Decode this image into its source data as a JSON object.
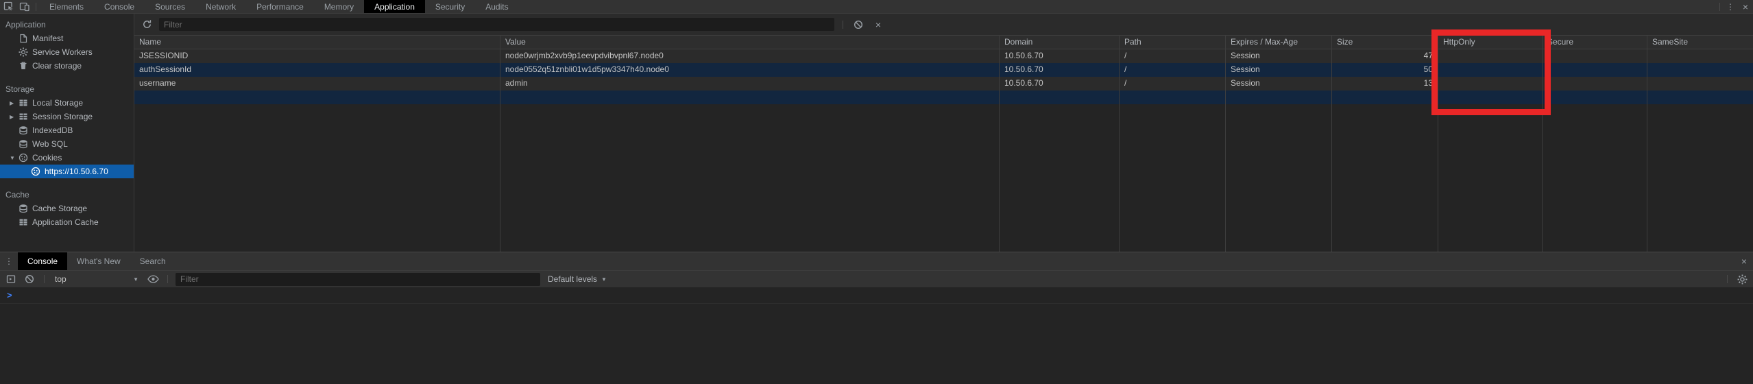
{
  "topbar": {
    "tabs": [
      {
        "label": "Elements",
        "active": false
      },
      {
        "label": "Console",
        "active": false
      },
      {
        "label": "Sources",
        "active": false
      },
      {
        "label": "Network",
        "active": false
      },
      {
        "label": "Performance",
        "active": false
      },
      {
        "label": "Memory",
        "active": false
      },
      {
        "label": "Application",
        "active": true
      },
      {
        "label": "Security",
        "active": false
      },
      {
        "label": "Audits",
        "active": false
      }
    ]
  },
  "icons": {
    "more_options": "⋮",
    "close": "×",
    "caret_down": "▼",
    "disclosure_collapsed": "▶",
    "disclosure_expanded": "▼"
  },
  "sidebar": {
    "sections": [
      {
        "title": "Application",
        "items": [
          {
            "label": "Manifest",
            "icon": "file-icon"
          },
          {
            "label": "Service Workers",
            "icon": "gear-icon"
          },
          {
            "label": "Clear storage",
            "icon": "trash-icon"
          }
        ]
      },
      {
        "title": "Storage",
        "items": [
          {
            "label": "Local Storage",
            "icon": "table-icon",
            "disclosure": "collapsed"
          },
          {
            "label": "Session Storage",
            "icon": "table-icon",
            "disclosure": "collapsed"
          },
          {
            "label": "IndexedDB",
            "icon": "database-icon"
          },
          {
            "label": "Web SQL",
            "icon": "database-icon"
          },
          {
            "label": "Cookies",
            "icon": "cookie-icon",
            "disclosure": "expanded"
          },
          {
            "label": "https://10.50.6.70",
            "icon": "cookie-icon",
            "selected": true
          }
        ]
      },
      {
        "title": "Cache",
        "items": [
          {
            "label": "Cache Storage",
            "icon": "database-icon"
          },
          {
            "label": "Application Cache",
            "icon": "table-icon"
          }
        ]
      }
    ]
  },
  "cookies": {
    "filter_placeholder": "Filter",
    "columns": [
      "Name",
      "Value",
      "Domain",
      "Path",
      "Expires / Max-Age",
      "Size",
      "HttpOnly",
      "Secure",
      "SameSite"
    ],
    "rows": [
      {
        "name": "JSESSIONID",
        "value": "node0wrjmb2xvb9p1eevpdvibvpnl67.node0",
        "domain": "10.50.6.70",
        "path": "/",
        "expires": "Session",
        "size": "47",
        "httponly": "",
        "secure": "",
        "samesite": ""
      },
      {
        "name": "authSessionId",
        "value": "node0552q51znbli01w1d5pw3347h40.node0",
        "domain": "10.50.6.70",
        "path": "/",
        "expires": "Session",
        "size": "50",
        "httponly": "",
        "secure": "",
        "samesite": ""
      },
      {
        "name": "username",
        "value": "admin",
        "domain": "10.50.6.70",
        "path": "/",
        "expires": "Session",
        "size": "13",
        "httponly": "",
        "secure": "",
        "samesite": ""
      }
    ]
  },
  "annotation": {
    "highlighted_column": "HttpOnly",
    "color": "#e92727"
  },
  "drawer": {
    "tabs": [
      {
        "label": "Console",
        "active": true
      },
      {
        "label": "What's New",
        "active": false
      },
      {
        "label": "Search",
        "active": false
      }
    ],
    "toolbar": {
      "context": "top",
      "filter_placeholder": "Filter",
      "levels_label": "Default levels"
    },
    "prompt_symbol": ">"
  }
}
